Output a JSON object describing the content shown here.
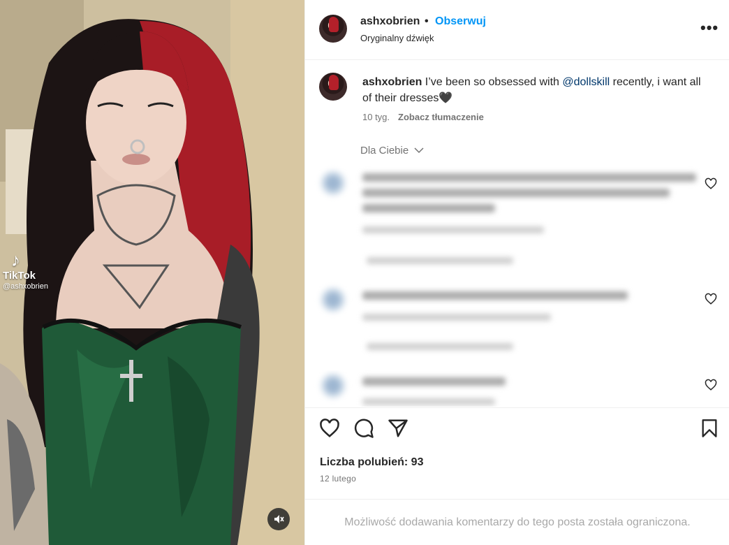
{
  "post_header": {
    "username": "ashxobrien",
    "separator": "•",
    "follow_label": "Obserwuj",
    "audio_label": "Oryginalny dźwięk",
    "more_label": "•••"
  },
  "media": {
    "watermark_brand": "TikTok",
    "watermark_handle": "@ashxobrien",
    "mute_icon": "volume-muted-icon"
  },
  "caption": {
    "username": "ashxobrien",
    "text_before": " I’ve been so obsessed with ",
    "mention": "@dollskill",
    "text_after": " recently, i want all of their dresses🖤",
    "age": "10 tyg.",
    "translate_label": "Zobacz tłumaczenie"
  },
  "comments_sort": {
    "label": "Dla Ciebie",
    "icon": "chevron-down-icon"
  },
  "actions": {
    "like_icon": "heart-icon",
    "comment_icon": "comment-icon",
    "share_icon": "send-icon",
    "save_icon": "bookmark-icon",
    "likes_label": "Liczba polubień: 93",
    "date": "12 lutego"
  },
  "restricted_notice": "Możliwość dodawania komentarzy do tego posta została ograniczona.",
  "colors": {
    "link_blue": "#0095f6",
    "mention_blue": "#00376b",
    "text_primary": "#262626",
    "text_secondary": "#737373",
    "dress_green": "#1f5a38",
    "hair_red": "#b3202a"
  }
}
